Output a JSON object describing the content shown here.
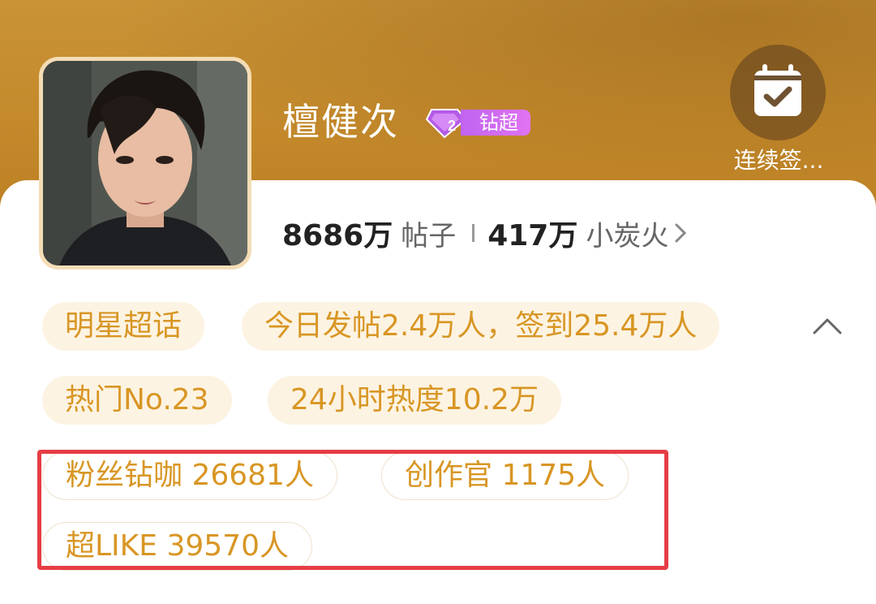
{
  "header": {
    "name": "檀健次",
    "badge_label": "钻超",
    "badge_level": "2",
    "checkin_label": "连续签...",
    "checkin_icon": "calendar-check-icon"
  },
  "stats": {
    "posts_count": "8686万",
    "posts_label": "帖子",
    "fire_count": "417万",
    "fire_label": "小炭火"
  },
  "tags": {
    "row1": [
      "明星超话",
      "今日发帖2.4万人，签到25.4万人"
    ],
    "row2": [
      "热门No.23",
      "24小时热度10.2万"
    ],
    "row3": [
      "粉丝钻咖 26681人",
      "创作官 1175人"
    ],
    "row4": [
      "超LIKE 39570人"
    ]
  },
  "colors": {
    "header_gold": "#c48a2c",
    "tag_text": "#d89624",
    "tag_bg": "#fdf3e2",
    "badge_purple": "#c064f0",
    "highlight_red": "#e63d45"
  }
}
